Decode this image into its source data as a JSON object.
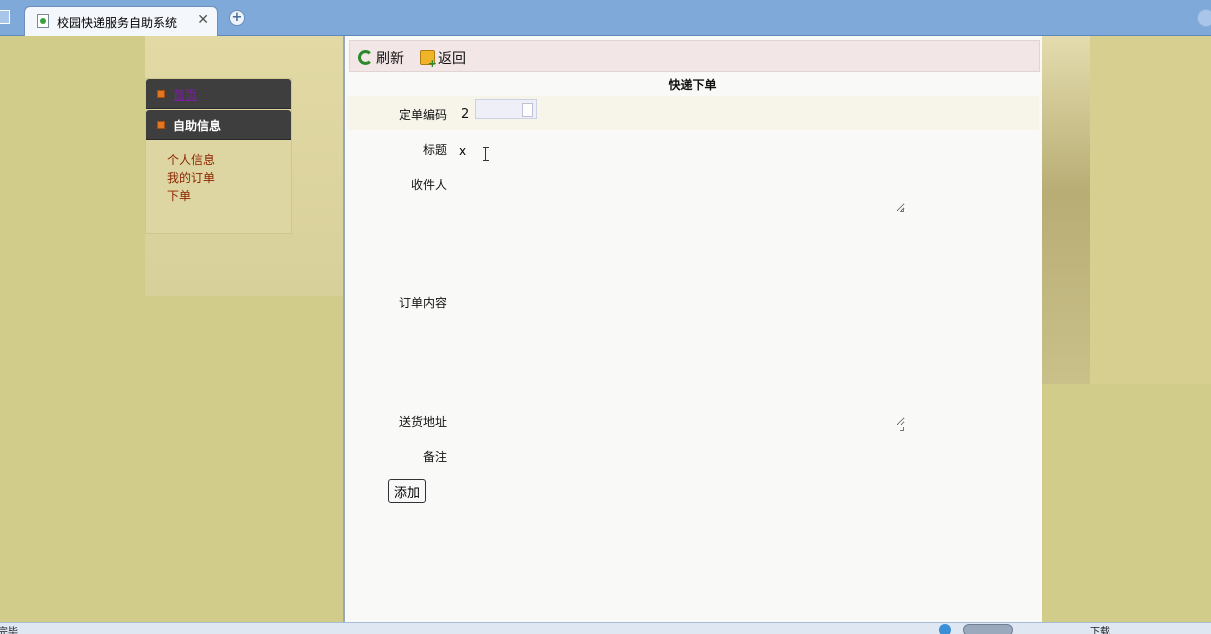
{
  "browser": {
    "tab_title": "校园快递服务自助系统",
    "tab_close": "✕",
    "new_tab": "+"
  },
  "nav": {
    "home_label": "首页",
    "section_label": "自助信息",
    "links": [
      "个人信息",
      "我的订单",
      "下单"
    ]
  },
  "toolbar": {
    "refresh_label": "刷新",
    "back_label": "返回"
  },
  "form": {
    "title": "快递下单",
    "order_code_label": "定单编码",
    "order_code_value": "2",
    "title_label": "标题",
    "title_value": "x",
    "recipient_label": "收件人",
    "content_label": "订单内容",
    "address_label": "送货地址",
    "remark_label": "备注",
    "submit_label": "添加"
  },
  "statusbar": {
    "status_text": "完毕",
    "download_label": "下载"
  },
  "colors": {
    "page_bg": "#d4cd89",
    "nav_head": "#3e3e3e",
    "nav_bullet": "#e27622",
    "link": "#8b2500",
    "toolbar_bg": "#f2e6e6",
    "tabstrip": "#7fa9d9"
  }
}
